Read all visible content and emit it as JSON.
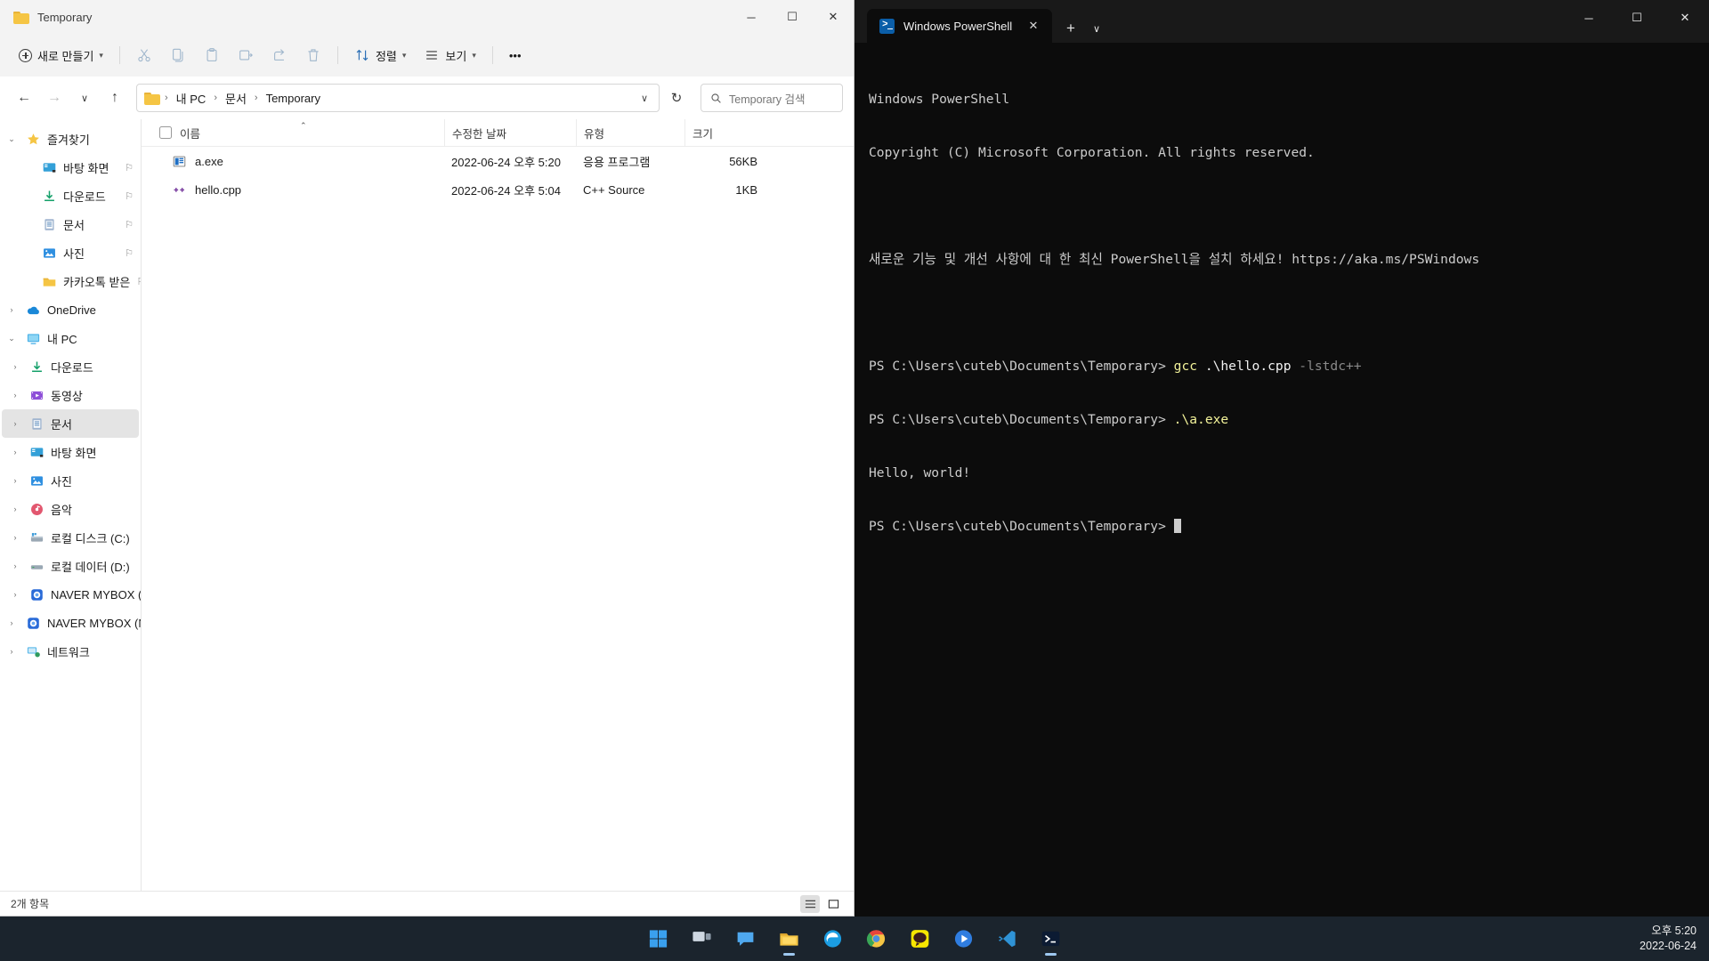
{
  "explorer": {
    "title": "Temporary",
    "window_controls": {
      "minimize": "─",
      "maximize": "☐",
      "close": "✕"
    },
    "toolbar": {
      "new_label": "새로 만들기",
      "cut": "cut-icon",
      "copy": "copy-icon",
      "paste": "paste-icon",
      "rename": "rename-icon",
      "share": "share-icon",
      "delete": "delete-icon",
      "sort_label": "정렬",
      "view_label": "보기",
      "more_label": "•••"
    },
    "address": {
      "back": "←",
      "forward": "→",
      "recent": "∨",
      "up": "↑",
      "crumbs": [
        "내 PC",
        "문서",
        "Temporary"
      ],
      "dropdown": "∨",
      "refresh": "↻",
      "search_placeholder": "Temporary 검색"
    },
    "sidebar": [
      {
        "label": "즐겨찾기",
        "icon": "star-icon",
        "arrow": "⌄",
        "depth": 0,
        "pin": false,
        "selected": false
      },
      {
        "label": "바탕 화면",
        "icon": "desktop-icon",
        "arrow": "",
        "depth": 1,
        "pin": true,
        "selected": false
      },
      {
        "label": "다운로드",
        "icon": "download-icon",
        "arrow": "",
        "depth": 1,
        "pin": true,
        "selected": false
      },
      {
        "label": "문서",
        "icon": "documents-icon",
        "arrow": "",
        "depth": 1,
        "pin": true,
        "selected": false
      },
      {
        "label": "사진",
        "icon": "pictures-icon",
        "arrow": "",
        "depth": 1,
        "pin": true,
        "selected": false
      },
      {
        "label": "카카오톡 받은",
        "icon": "folder-icon",
        "arrow": "",
        "depth": 1,
        "pin": true,
        "selected": false
      },
      {
        "label": "OneDrive",
        "icon": "onedrive-icon",
        "arrow": "›",
        "depth": 0,
        "pin": false,
        "selected": false
      },
      {
        "label": "내 PC",
        "icon": "pc-icon",
        "arrow": "⌄",
        "depth": 0,
        "pin": false,
        "selected": false
      },
      {
        "label": "다운로드",
        "icon": "download-icon",
        "arrow": "›",
        "depth": 2,
        "pin": false,
        "selected": false
      },
      {
        "label": "동영상",
        "icon": "videos-icon",
        "arrow": "›",
        "depth": 2,
        "pin": false,
        "selected": false
      },
      {
        "label": "문서",
        "icon": "documents-icon",
        "arrow": "›",
        "depth": 2,
        "pin": false,
        "selected": true
      },
      {
        "label": "바탕 화면",
        "icon": "desktop-icon",
        "arrow": "›",
        "depth": 2,
        "pin": false,
        "selected": false
      },
      {
        "label": "사진",
        "icon": "pictures-icon",
        "arrow": "›",
        "depth": 2,
        "pin": false,
        "selected": false
      },
      {
        "label": "음악",
        "icon": "music-icon",
        "arrow": "›",
        "depth": 2,
        "pin": false,
        "selected": false
      },
      {
        "label": "로컬 디스크 (C:)",
        "icon": "local-disk-icon",
        "arrow": "›",
        "depth": 2,
        "pin": false,
        "selected": false
      },
      {
        "label": "로컬 데이터 (D:)",
        "icon": "drive-icon",
        "arrow": "›",
        "depth": 2,
        "pin": false,
        "selected": false
      },
      {
        "label": "NAVER MYBOX (N",
        "icon": "naver-mybox-icon",
        "arrow": "›",
        "depth": 2,
        "pin": false,
        "selected": false
      },
      {
        "label": "NAVER MYBOX (N:",
        "icon": "naver-mybox-icon",
        "arrow": "›",
        "depth": 0,
        "pin": false,
        "selected": false
      },
      {
        "label": "네트워크",
        "icon": "network-icon",
        "arrow": "›",
        "depth": 0,
        "pin": false,
        "selected": false
      }
    ],
    "columns": [
      "이름",
      "수정한 날짜",
      "유형",
      "크기"
    ],
    "sort_indicator": "⌃",
    "files": [
      {
        "name": "a.exe",
        "icon": "exe-icon",
        "date": "2022-06-24 오후 5:20",
        "type": "응용 프로그램",
        "size": "56KB"
      },
      {
        "name": "hello.cpp",
        "icon": "cpp-source-icon",
        "date": "2022-06-24 오후 5:04",
        "type": "C++ Source",
        "size": "1KB"
      }
    ],
    "status": "2개 항목",
    "view_toggles": {
      "details": "details-view",
      "tiles": "tiles-view"
    }
  },
  "terminal": {
    "tab_title": "Windows PowerShell",
    "tab_close": "✕",
    "tab_new": "+",
    "tab_dropdown": "∨",
    "window_controls": {
      "minimize": "─",
      "maximize": "☐",
      "close": "✕"
    },
    "lines": {
      "l1": "Windows PowerShell",
      "l2": "Copyright (C) Microsoft Corporation. All rights reserved.",
      "l3": "새로운 기능 및 개선 사항에 대 한 최신 PowerShell을 설치 하세요! https://aka.ms/PSWindows",
      "prompt1": "PS C:\\Users\\cuteb\\Documents\\Temporary>",
      "cmd1_exe": "gcc",
      "cmd1_arg": ".\\hello.cpp",
      "cmd1_flag": "-lstdc++",
      "prompt2": "PS C:\\Users\\cuteb\\Documents\\Temporary>",
      "cmd2": ".\\a.exe",
      "output1": "Hello, world!",
      "prompt3": "PS C:\\Users\\cuteb\\Documents\\Temporary>"
    }
  },
  "taskbar": {
    "items": [
      {
        "name": "start-button",
        "icon": "windows-logo-icon"
      },
      {
        "name": "task-view-button",
        "icon": "task-view-icon"
      },
      {
        "name": "chat-button",
        "icon": "chat-icon"
      },
      {
        "name": "file-explorer-button",
        "icon": "file-explorer-icon",
        "running": true
      },
      {
        "name": "edge-button",
        "icon": "edge-icon"
      },
      {
        "name": "chrome-button",
        "icon": "chrome-icon"
      },
      {
        "name": "kakaotalk-button",
        "icon": "kakaotalk-icon"
      },
      {
        "name": "media-player-button",
        "icon": "media-player-icon"
      },
      {
        "name": "vscode-button",
        "icon": "vscode-icon"
      },
      {
        "name": "powershell-button",
        "icon": "powershell-icon",
        "running": true
      }
    ],
    "clock_time": "오후 5:20",
    "clock_date": "2022-06-24"
  },
  "colors": {
    "accent": "#0b5ea8",
    "terminal_bg": "#0c0c0c",
    "terminal_yellow": "#f3f39a",
    "folder_yellow": "#f5c544",
    "selection": "#e4e4e4"
  }
}
